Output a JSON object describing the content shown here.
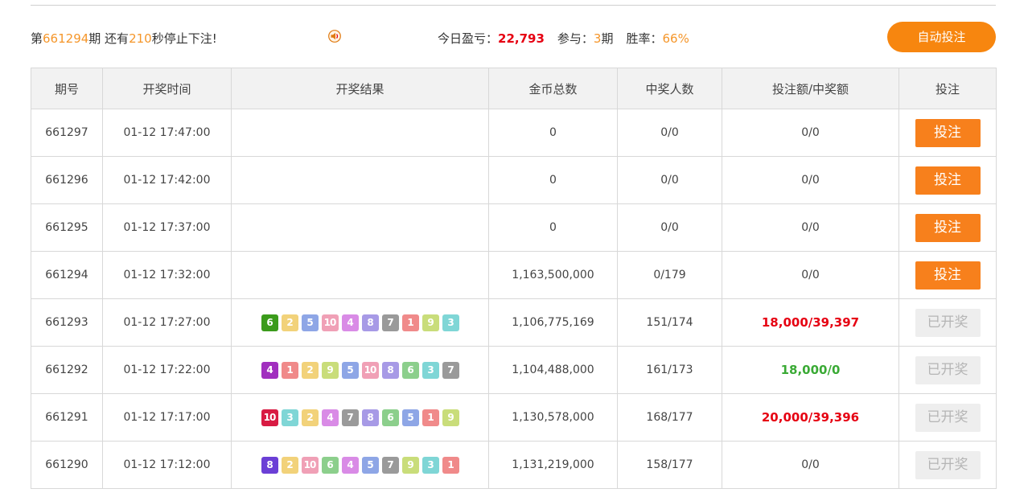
{
  "countdown": {
    "prefix": "第",
    "period": "661294",
    "middle": "期 还有",
    "seconds": "210",
    "suffix": "秒停止下注!"
  },
  "stats": {
    "profit_label": "今日盈亏：",
    "profit_value": "22,793",
    "join_label": "参与：",
    "join_value": "3",
    "join_unit": "期",
    "winrate_label": "胜率：",
    "winrate_value": "66%"
  },
  "auto_button": "自动投注",
  "table": {
    "headers": [
      "期号",
      "开奖时间",
      "开奖结果",
      "金币总数",
      "中奖人数",
      "投注额/中奖额",
      "投注"
    ],
    "rows": [
      {
        "period": "661297",
        "time": "01-12 17:47:00",
        "balls": [],
        "coins": "0",
        "winners": "0/0",
        "amount": "0/0",
        "amount_style": "plain",
        "action": "投注",
        "action_type": "bet"
      },
      {
        "period": "661296",
        "time": "01-12 17:42:00",
        "balls": [],
        "coins": "0",
        "winners": "0/0",
        "amount": "0/0",
        "amount_style": "plain",
        "action": "投注",
        "action_type": "bet"
      },
      {
        "period": "661295",
        "time": "01-12 17:37:00",
        "balls": [],
        "coins": "0",
        "winners": "0/0",
        "amount": "0/0",
        "amount_style": "plain",
        "action": "投注",
        "action_type": "bet"
      },
      {
        "period": "661294",
        "time": "01-12 17:32:00",
        "balls": [],
        "coins": "1,163,500,000",
        "winners": "0/179",
        "amount": "0/0",
        "amount_style": "plain",
        "action": "投注",
        "action_type": "bet"
      },
      {
        "period": "661293",
        "time": "01-12 17:27:00",
        "balls": [
          "6",
          "2",
          "5",
          "10",
          "4",
          "8",
          "7",
          "1",
          "9",
          "3"
        ],
        "coins": "1,106,775,169",
        "winners": "151/174",
        "amount": "18,000/39,397",
        "amount_style": "red",
        "action": "已开奖",
        "action_type": "done"
      },
      {
        "period": "661292",
        "time": "01-12 17:22:00",
        "balls": [
          "4",
          "1",
          "2",
          "9",
          "5",
          "10",
          "8",
          "6",
          "3",
          "7"
        ],
        "coins": "1,104,488,000",
        "winners": "161/173",
        "amount": "18,000/0",
        "amount_style": "green",
        "action": "已开奖",
        "action_type": "done"
      },
      {
        "period": "661291",
        "time": "01-12 17:17:00",
        "balls": [
          "10",
          "3",
          "2",
          "4",
          "7",
          "8",
          "6",
          "5",
          "1",
          "9"
        ],
        "coins": "1,130,578,000",
        "winners": "168/177",
        "amount": "20,000/39,396",
        "amount_style": "red",
        "action": "已开奖",
        "action_type": "done"
      },
      {
        "period": "661290",
        "time": "01-12 17:12:00",
        "balls": [
          "8",
          "2",
          "10",
          "6",
          "4",
          "5",
          "7",
          "9",
          "3",
          "1"
        ],
        "coins": "1,131,219,000",
        "winners": "158/177",
        "amount": "0/0",
        "amount_style": "plain",
        "action": "已开奖",
        "action_type": "done"
      }
    ]
  },
  "ball_colors": {
    "1": "#f08a8a",
    "2": "#f2d27a",
    "3": "#7fd6d6",
    "4": "#d98be6",
    "5": "#8ea6e6",
    "6": "#8ccf8c",
    "7": "#9a9a9a",
    "8": "#a79ae6",
    "9": "#c9dd7a",
    "10": "#f0a0b6"
  },
  "first_ball_colors": {
    "6": "#3b9b1b",
    "4": "#a12fbf",
    "10": "#d81b43",
    "8": "#6b3fd6"
  }
}
